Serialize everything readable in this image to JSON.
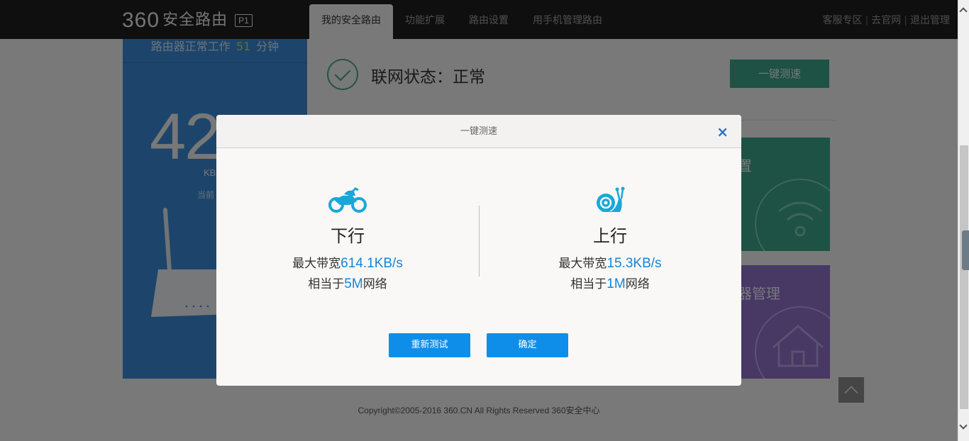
{
  "header": {
    "brand_360": "360",
    "brand_name": "安全路由",
    "brand_model": "P1",
    "tabs": [
      {
        "label": "我的安全路由",
        "active": true
      },
      {
        "label": "功能扩展",
        "active": false
      },
      {
        "label": "路由设置",
        "active": false
      },
      {
        "label": "用手机管理路由",
        "active": false
      }
    ],
    "links": [
      "客服专区",
      "去官网",
      "退出管理"
    ]
  },
  "left_panel": {
    "uptime_prefix": "路由器正常工作",
    "uptime_value": "51",
    "uptime_unit": "分钟",
    "speed_partial": "42.",
    "speed_unit_partial": "KB",
    "current_partial": "当前"
  },
  "status": {
    "text": "联网状态：正常",
    "speedtest_button": "一键测速"
  },
  "tiles": {
    "green_title_partial": "置",
    "purple_title_partial": "器管理"
  },
  "footer": {
    "copyright": "Copyright©2005-2016 360.CN All Rights Reserved 360安全中心"
  },
  "dialog": {
    "title": "一键测速",
    "close": "×",
    "download": {
      "direction": "下行",
      "bw_prefix": "最大带宽",
      "bw_value": "614.1KB/s",
      "eq_prefix": "相当于",
      "eq_value": "5M",
      "eq_suffix": "网络"
    },
    "upload": {
      "direction": "上行",
      "bw_prefix": "最大带宽",
      "bw_value": "15.3KB/s",
      "eq_prefix": "相当于",
      "eq_value": "1M",
      "eq_suffix": "网络"
    },
    "retest_button": "重新测试",
    "ok_button": "确定"
  },
  "colors": {
    "accent_blue": "#0f8ee9",
    "highlight_blue": "#1585d8",
    "icon_cyan": "#1aa7d8",
    "panel_blue": "#3b8ad6",
    "tile_green": "#3aa58a",
    "tile_purple": "#8e71c9"
  }
}
